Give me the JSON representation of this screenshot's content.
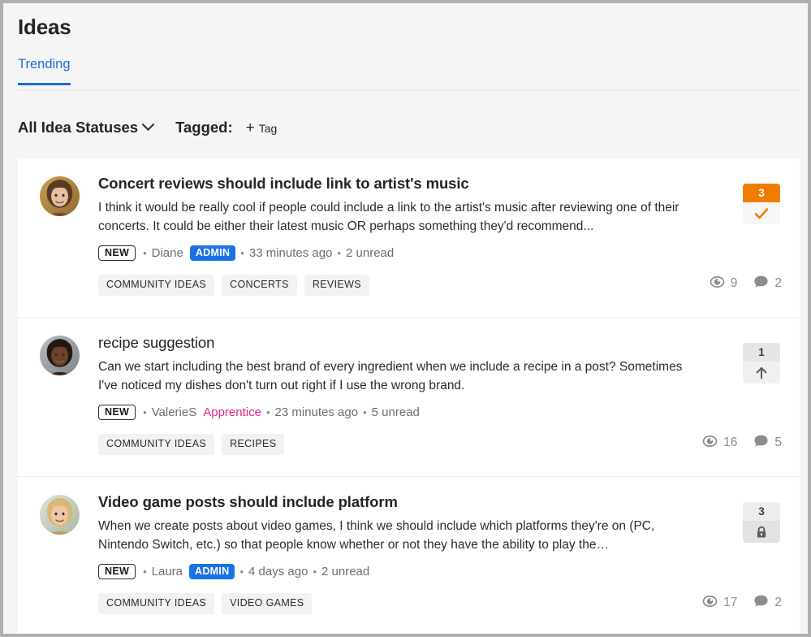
{
  "header": {
    "title": "Ideas",
    "tab": "Trending"
  },
  "filters": {
    "status_label": "All Idea Statuses",
    "status_icon": "chevron-down-icon",
    "tagged_label": "Tagged:",
    "add_tag_plus": "+",
    "add_tag_label": "Tag"
  },
  "colors": {
    "accent_blue": "#1b6ed8",
    "admin_blue": "#1b72e8",
    "solved_orange": "#f07d00",
    "apprentice_pink": "#e5258f",
    "page_bg": "#f5f5f5",
    "card_bg": "#ffffff"
  },
  "ideas": [
    {
      "title": "Concert reviews should include link to artist's music",
      "title_bold": true,
      "text": "I think it would be really cool if people could include a link to the artist's music after reviewing one of their concerts. It could be either their latest music OR perhaps something they'd recommend...",
      "status_badge": "NEW",
      "author": "Diane",
      "rank": "ADMIN",
      "rank_style": "admin",
      "time": "33 minutes ago",
      "unread": "2 unread",
      "tags": [
        "COMMUNITY IDEAS",
        "CONCERTS",
        "REVIEWS"
      ],
      "kudos_count": "3",
      "kudos_style": "solved",
      "kudos_icon": "check-icon",
      "views": "9",
      "views_icon": "eye-icon",
      "comments": "2",
      "comments_icon": "comment-icon",
      "avatar": "avatar-diane"
    },
    {
      "title": "recipe suggestion",
      "title_bold": false,
      "text": "Can we start including the best brand of every ingredient when we include a recipe in a post? Sometimes I've noticed my dishes don't turn out right if I use the wrong brand.",
      "status_badge": "NEW",
      "author": "ValerieS",
      "rank": "Apprentice",
      "rank_style": "plain",
      "time": "23 minutes ago",
      "unread": "5 unread",
      "tags": [
        "COMMUNITY IDEAS",
        "RECIPES"
      ],
      "kudos_count": "1",
      "kudos_style": "plain",
      "kudos_icon": "arrow-up-icon",
      "views": "16",
      "views_icon": "eye-icon",
      "comments": "5",
      "comments_icon": "comment-icon",
      "avatar": "avatar-valeries"
    },
    {
      "title": "Video game posts should include platform",
      "title_bold": true,
      "text": "When we create posts about video games, I think we should include which platforms they're on (PC, Nintendo Switch, etc.) so that people know whether or not they have the ability to play the…",
      "status_badge": "NEW",
      "author": "Laura",
      "rank": "ADMIN",
      "rank_style": "admin",
      "time": "4 days ago",
      "unread": "2 unread",
      "tags": [
        "COMMUNITY IDEAS",
        "VIDEO GAMES"
      ],
      "kudos_count": "3",
      "kudos_style": "locked",
      "kudos_icon": "lock-icon",
      "views": "17",
      "views_icon": "eye-icon",
      "comments": "2",
      "comments_icon": "comment-icon",
      "avatar": "avatar-laura"
    }
  ]
}
